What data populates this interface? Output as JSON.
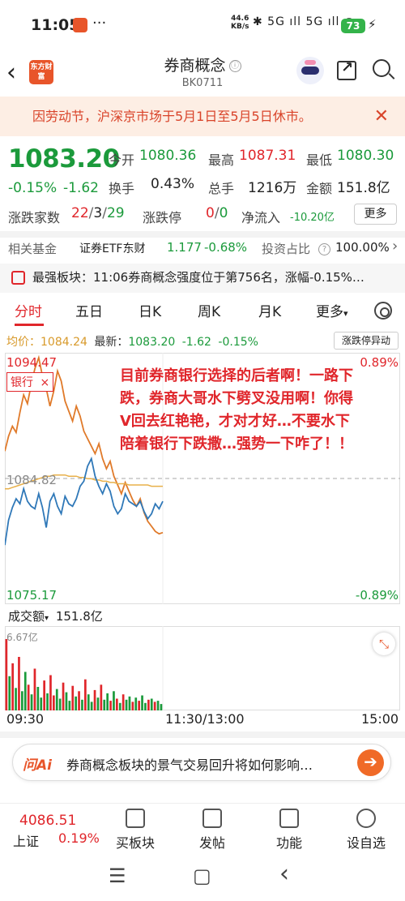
{
  "status_bar": {
    "time": "11:05",
    "more": "···",
    "speed_value": "44.6",
    "speed_unit": "KB/s",
    "signal": "✱ 5G ıll 5G ıll ◉",
    "battery": "73"
  },
  "header": {
    "logo_text": "东方财富",
    "title": "券商概念",
    "info_icon": "ⓘ",
    "code": "BK0711"
  },
  "notice": {
    "text": "因劳动节，沪深京市场于5月1日至5月5日休市。",
    "close": "✕"
  },
  "quote": {
    "price": "1083.20",
    "change_pct": "-0.15%",
    "change": "-1.62",
    "open_label": "今开",
    "open_value": "1080.36",
    "high_label": "最高",
    "high_value": "1087.31",
    "low_label": "最低",
    "low_value": "1080.30",
    "turnover_label": "换手",
    "turnover_value": "0.43%",
    "volume_label": "总手",
    "volume_value": "1216万",
    "amount_label": "金额",
    "amount_value": "151.8亿",
    "updown_label": "涨跌家数",
    "updown_up": "22",
    "updown_sep1": "/",
    "updown_flat": "3",
    "updown_sep2": "/",
    "updown_down": "29",
    "limit_label": "涨跌停",
    "limit_up": "0",
    "limit_sep": "/",
    "limit_down": "0",
    "netflow_label": "净流入",
    "netflow_value": "-10.20亿",
    "more_button": "更多"
  },
  "fund_row": {
    "label": "相关基金",
    "fund_name": "证券ETF东财",
    "fund_price": "1.177",
    "fund_pct": "-0.68%",
    "ratio_label": "投资占比",
    "ratio_value": "100.00%",
    "arrow": "›"
  },
  "strongest": {
    "text": "最强板块：11:06券商概念强度位于第756名，涨幅-0.15%…"
  },
  "tabs": {
    "items": [
      "分时",
      "五日",
      "日K",
      "周K",
      "月K",
      "更多"
    ],
    "more_caret": "▾"
  },
  "legend": {
    "avg_label": "均价：",
    "avg_value": "1084.24",
    "latest_label": "最新：",
    "latest_value": "1083.20",
    "latest_change": "-1.62",
    "latest_pct": "-0.15%",
    "limit_button": "涨跌停异动"
  },
  "chart_labels": {
    "y_top": "1094.47",
    "y_mid": "1084.82",
    "y_bottom": "1075.17",
    "pct_top": "0.89%",
    "pct_bottom": "-0.89%",
    "compare_tag": "银行",
    "compare_close": "×",
    "overlay_text": "目前券商银行选择的后者啊！一路下跌，券商大哥水下劈叉没用啊！你得V回去红艳艳，才对才好…不要水下陪着银行下跌撒…强势一下咋了！！"
  },
  "chart_data": {
    "type": "line",
    "ylim": [
      1075.17,
      1094.47
    ],
    "prev_close": 1084.82,
    "x_start": "09:30",
    "x_mid": "11:30/13:00",
    "x_end": "15:00",
    "series": [
      {
        "name": "券商概念",
        "color": "#e07a2a",
        "values": [
          1087.0,
          1088.2,
          1089.0,
          1088.5,
          1090.1,
          1091.5,
          1090.8,
          1092.3,
          1093.6,
          1094.47,
          1093.0,
          1092.0,
          1090.6,
          1091.8,
          1093.4,
          1092.6,
          1091.0,
          1090.2,
          1089.4,
          1090.6,
          1089.8,
          1088.6,
          1088.0,
          1087.4,
          1086.8,
          1087.6,
          1086.4,
          1085.6,
          1086.2,
          1085.0,
          1084.3,
          1083.6,
          1084.5,
          1083.8,
          1083.1,
          1082.6,
          1083.2,
          1082.1,
          1081.4,
          1081.0,
          1080.6,
          1080.4,
          1080.5
        ]
      },
      {
        "name": "均价",
        "color": "#e8b04a",
        "values": [
          1084.0,
          1084.0,
          1084.1,
          1084.2,
          1084.3,
          1084.4,
          1084.5,
          1084.6,
          1084.7,
          1084.8,
          1084.9,
          1085.0,
          1085.0,
          1085.1,
          1085.1,
          1085.1,
          1085.1,
          1085.0,
          1085.0,
          1085.0,
          1084.9,
          1084.9,
          1084.8,
          1084.8,
          1084.7,
          1084.7,
          1084.6,
          1084.6,
          1084.5,
          1084.5,
          1084.4,
          1084.4,
          1084.4,
          1084.3,
          1084.3,
          1084.3,
          1084.3,
          1084.3,
          1084.3,
          1084.2,
          1084.2,
          1084.2,
          1084.2
        ]
      },
      {
        "name": "银行",
        "color": "#2f78b8",
        "values": [
          1079.5,
          1081.5,
          1082.5,
          1083.2,
          1082.8,
          1084.0,
          1083.0,
          1082.6,
          1082.4,
          1083.6,
          1082.5,
          1080.9,
          1083.0,
          1083.6,
          1082.6,
          1082.0,
          1083.4,
          1082.8,
          1082.6,
          1083.2,
          1084.2,
          1084.6,
          1085.8,
          1086.4,
          1085.0,
          1084.2,
          1083.6,
          1084.4,
          1083.8,
          1082.6,
          1082.0,
          1082.4,
          1083.6,
          1083.0,
          1082.8,
          1082.6,
          1083.0,
          1082.2,
          1081.6,
          1082.0,
          1082.8,
          1082.4,
          1083.0
        ]
      }
    ],
    "volume": {
      "max_label": "6.67亿",
      "values": [
        6.67,
        3.2,
        4.4,
        2.1,
        5.0,
        1.8,
        3.6,
        2.4,
        1.5,
        3.9,
        2.2,
        1.2,
        2.8,
        1.6,
        3.3,
        1.4,
        2.0,
        1.1,
        2.6,
        1.7,
        0.9,
        2.3,
        1.3,
        1.8,
        1.0,
        2.9,
        1.5,
        0.8,
        1.9,
        1.2,
        2.4,
        1.0,
        1.6,
        0.9,
        1.8,
        1.1,
        0.7,
        1.5,
        1.0,
        1.3,
        0.8,
        1.2,
        0.9,
        1.4,
        0.7,
        1.0,
        1.1,
        0.8,
        0.9,
        0.6
      ],
      "colors": [
        "r",
        "g",
        "r",
        "g",
        "r",
        "g",
        "g",
        "r",
        "g",
        "r",
        "g",
        "g",
        "r",
        "g",
        "r",
        "r",
        "g",
        "g",
        "r",
        "g",
        "g",
        "r",
        "g",
        "r",
        "g",
        "r",
        "g",
        "g",
        "r",
        "g",
        "r",
        "g",
        "g",
        "r",
        "g",
        "r",
        "g",
        "r",
        "g",
        "g",
        "r",
        "g",
        "r",
        "g",
        "g",
        "r",
        "g",
        "r",
        "g",
        "g"
      ]
    }
  },
  "volume_header": {
    "label": "成交额",
    "caret": "▾",
    "value": "151.8亿",
    "expand": "⤡"
  },
  "ai_bar": {
    "brand": "问Ai",
    "text": "券商概念板块的景气交易回升将如何影响…",
    "go": "➔"
  },
  "bottom_nav": {
    "index_value": "4086.51",
    "index_name": "上证",
    "index_pct": "0.19%",
    "items": [
      "买板块",
      "发帖",
      "功能",
      "设自选"
    ]
  },
  "system_nav": {
    "menu": "☰",
    "home": "▢",
    "back": "‹"
  },
  "colors": {
    "red": "#e0262b",
    "green": "#1b9a3b",
    "orange": "#e8552a",
    "notice_bg": "#fdeee4"
  }
}
